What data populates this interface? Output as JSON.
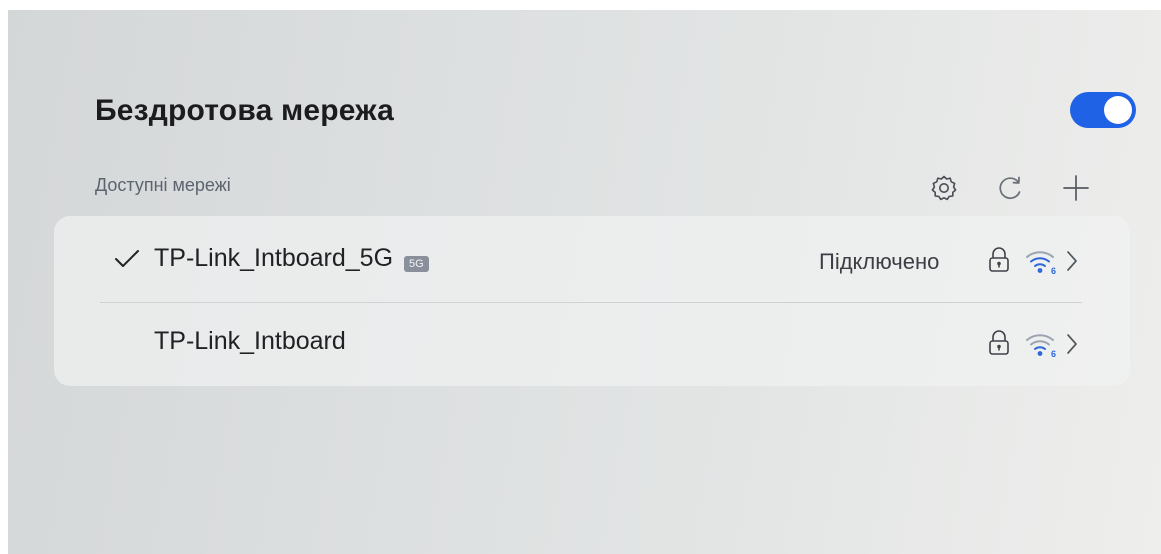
{
  "header": {
    "title": "Бездротова мережа",
    "wifi_toggle_on": true,
    "accent_color": "#1f62e6"
  },
  "section": {
    "label": "Доступні мережі"
  },
  "toolbar": {
    "icons": [
      "settings-gear-icon",
      "refresh-icon",
      "add-icon"
    ]
  },
  "networks": [
    {
      "name": "TP-Link_Intboard_5G",
      "badge": "5G",
      "status": "Підключено",
      "connected": true,
      "secured": true,
      "signal_icon": "wifi-6-icon"
    },
    {
      "name": "TP-Link_Intboard",
      "badge": "",
      "status": "",
      "connected": false,
      "secured": true,
      "signal_icon": "wifi-6-icon"
    }
  ]
}
